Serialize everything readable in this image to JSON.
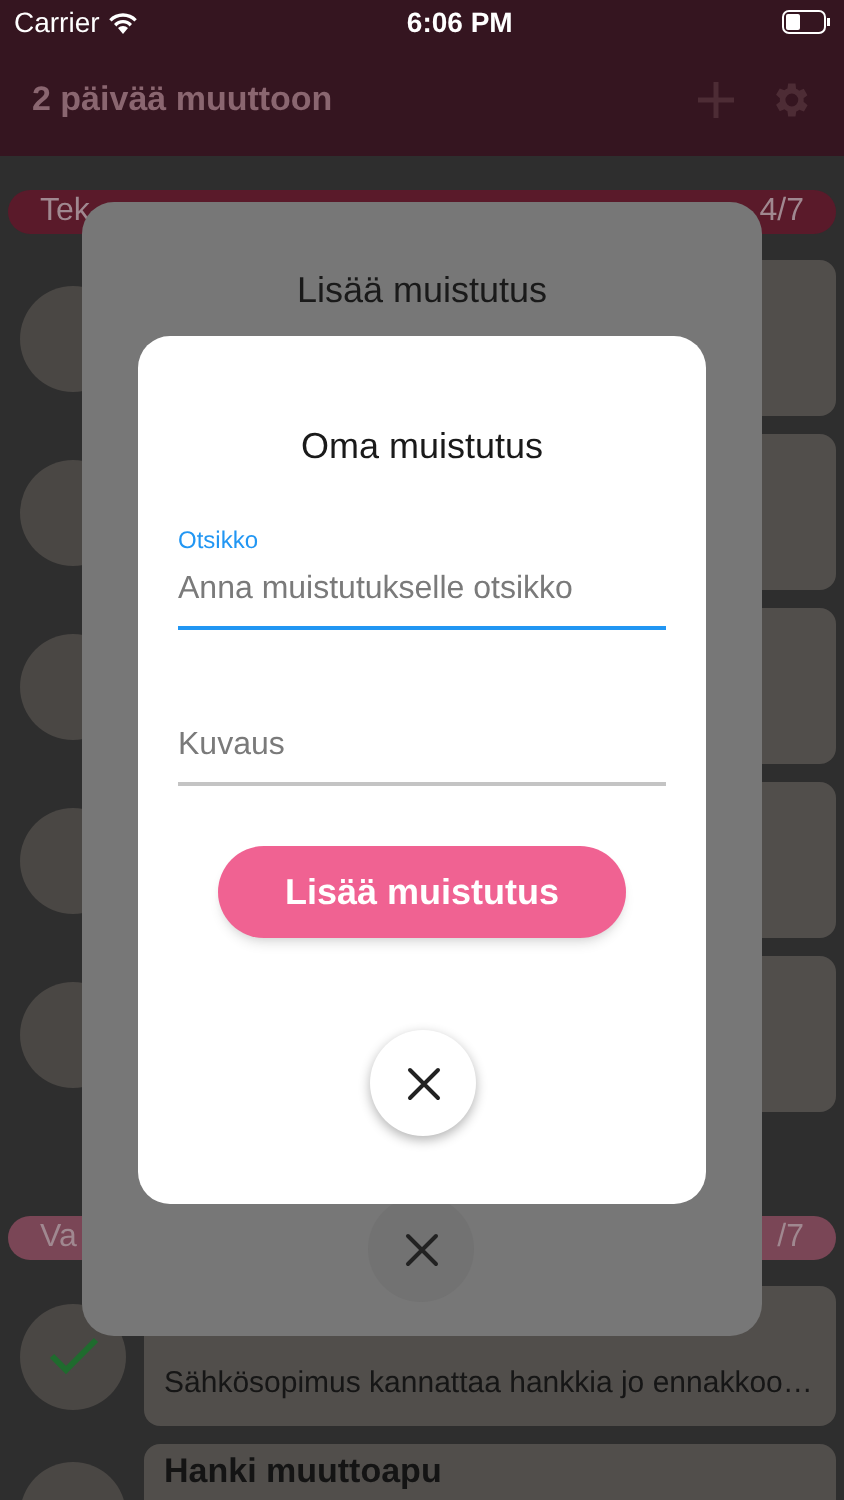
{
  "status_bar": {
    "carrier": "Carrier",
    "time": "6:06 PM"
  },
  "header": {
    "title": "2 päivää muuttoon"
  },
  "sections": [
    {
      "label": "Tek",
      "count": "4/7",
      "color": "#5a1a2a",
      "tasks": [
        {
          "done": false
        },
        {
          "done": false
        },
        {
          "done": false
        },
        {
          "done": false
        },
        {
          "done": false
        }
      ]
    },
    {
      "label": "Va",
      "count": "/7",
      "color": "#7a4656",
      "tasks": [
        {
          "done": true,
          "description": "Sähkösopimus kannattaa hankkia jo ennakkoo…"
        },
        {
          "done": false,
          "title": "Hanki muuttoapu"
        }
      ]
    }
  ],
  "outer_dialog": {
    "title": "Lisää muistutus"
  },
  "dialog": {
    "title": "Oma muistutus",
    "fields": [
      {
        "label": "Otsikko",
        "placeholder": "Anna muistutukselle otsikko",
        "focused": true
      },
      {
        "placeholder": "Kuvaus",
        "focused": false
      }
    ],
    "submit": "Lisää muistutus"
  }
}
